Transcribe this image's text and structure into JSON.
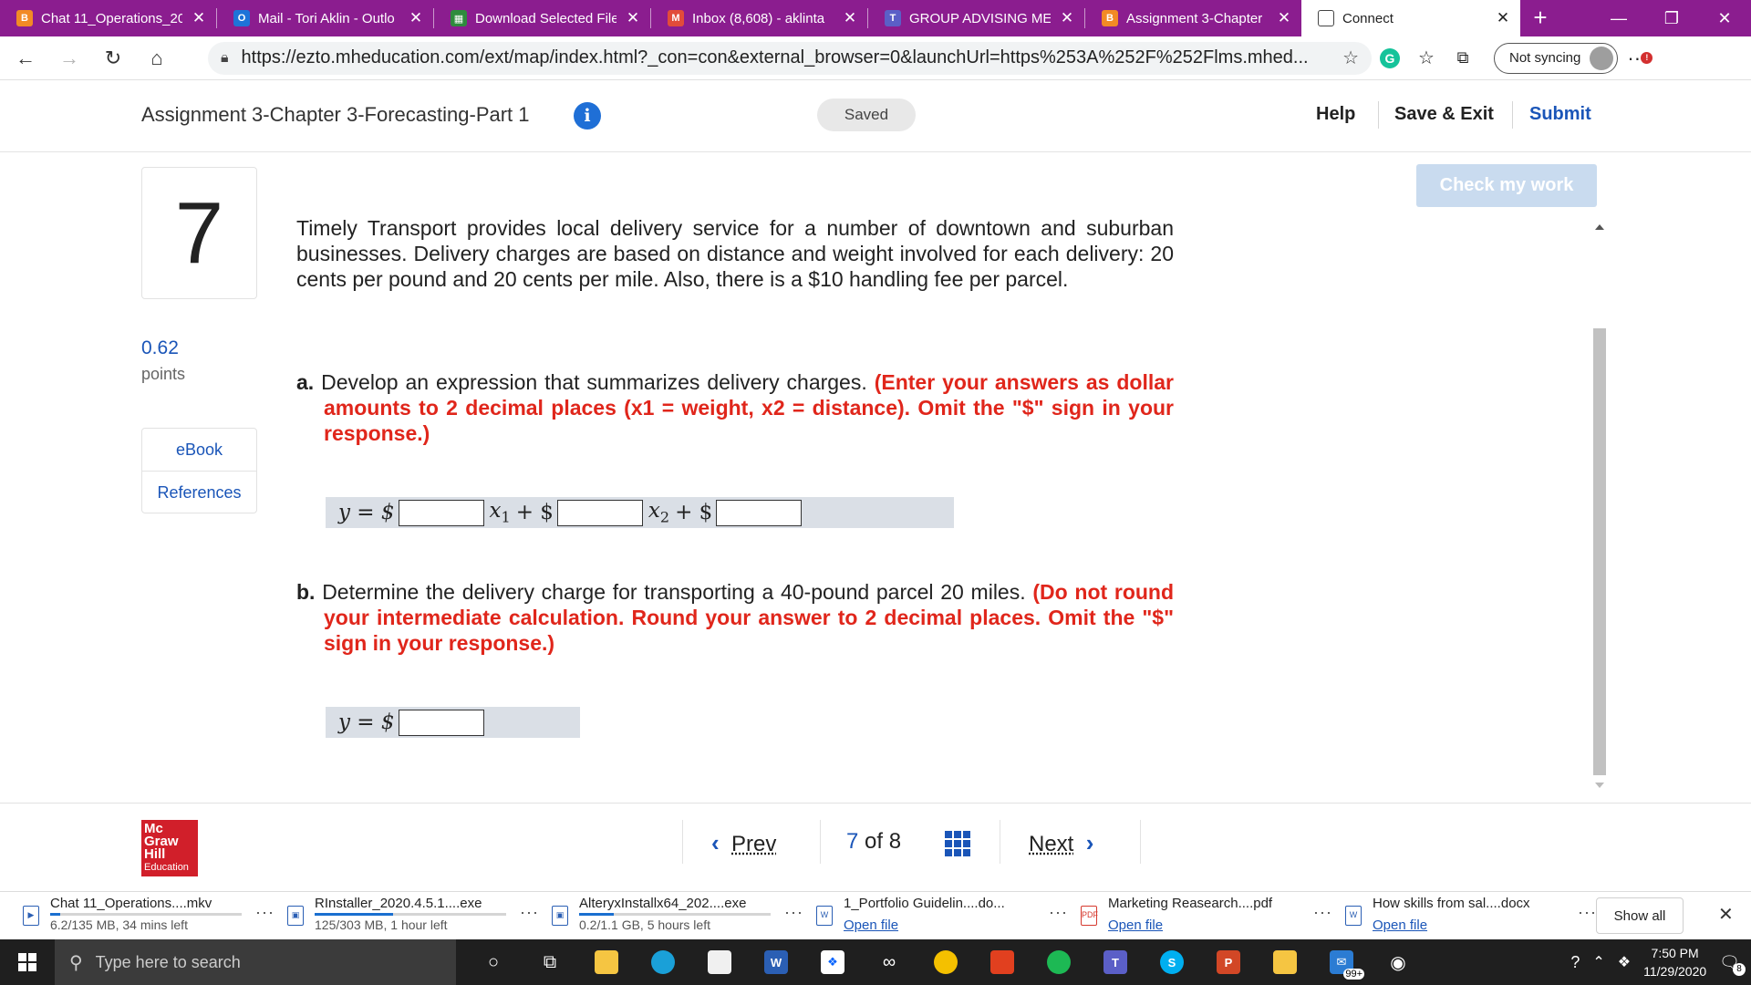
{
  "browser": {
    "tabs": [
      {
        "title": "Chat 11_Operations_20",
        "favicon": "B",
        "color": "#f28a25",
        "active": false
      },
      {
        "title": "Mail - Tori Aklin - Outlo",
        "favicon": "O",
        "color": "#1e73d8",
        "active": false
      },
      {
        "title": "Download Selected File",
        "favicon": "▦",
        "color": "#2e8b3d",
        "active": false
      },
      {
        "title": "Inbox (8,608) - aklinta",
        "favicon": "M",
        "color": "#e24c3a",
        "active": false
      },
      {
        "title": "GROUP ADVISING ME",
        "favicon": "T",
        "color": "#5b5fc7",
        "active": false
      },
      {
        "title": "Assignment 3-Chapter",
        "favicon": "B",
        "color": "#f28a25",
        "active": false
      },
      {
        "title": "Connect",
        "favicon": "▢",
        "color": "#ffffff",
        "active": true
      }
    ],
    "url": "https://ezto.mheducation.com/ext/map/index.html?_con=con&external_browser=0&launchUrl=https%253A%252F%252Flms.mhed...",
    "sync_label": "Not syncing",
    "menu_badge": "!"
  },
  "header": {
    "title": "Assignment 3-Chapter 3-Forecasting-Part 1",
    "info_glyph": "i",
    "saved": "Saved",
    "help": "Help",
    "save_exit": "Save & Exit",
    "submit": "Submit"
  },
  "question": {
    "number": "7",
    "points_value": "0.62",
    "points_label": "points",
    "ebook": "eBook",
    "references": "References",
    "check_button": "Check my work",
    "stem": "Timely Transport provides local delivery service for a number of downtown and suburban businesses. Delivery charges are based on distance and weight involved for each delivery: 20 cents per pound and 20 cents per mile. Also, there is a $10 handling fee per parcel.",
    "part_a": {
      "label": "a.",
      "text": "Develop an expression that summarizes delivery charges.",
      "instruction": "(Enter your answers as dollar amounts to 2 decimal places (x1 = weight, x2 = distance).  Omit the \"$\" sign in your response.)",
      "y_prefix": "y = $",
      "x1_label": "x",
      "x1_sub": "1",
      "plus1": "+ $",
      "x2_label": "x",
      "x2_sub": "2",
      "plus2": "+ $",
      "values": [
        "",
        "",
        ""
      ]
    },
    "part_b": {
      "label": "b.",
      "text": "Determine the delivery charge for transporting a 40-pound parcel 20 miles.",
      "instruction": "(Do not round your intermediate calculation. Round your answer to 2 decimal places. Omit the \"$\" sign in your response.)",
      "y_prefix": "y = $",
      "value": ""
    }
  },
  "footer": {
    "logo_lines": [
      "Mc",
      "Graw",
      "Hill"
    ],
    "logo_sub": "Education",
    "prev": "Prev",
    "page_current": "7",
    "page_of": "of",
    "page_total": "8",
    "next": "Next"
  },
  "downloads": {
    "items": [
      {
        "name": "Chat 11_Operations....mkv",
        "status": "6.2/135 MB, 34 mins left",
        "progress": 0.05,
        "kind": "video"
      },
      {
        "name": "RInstaller_2020.4.5.1....exe",
        "status": "125/303 MB, 1 hour left",
        "progress": 0.41,
        "kind": "exe"
      },
      {
        "name": "AlteryxInstallx64_202....exe",
        "status": "0.2/1.1 GB, 5 hours left",
        "progress": 0.18,
        "kind": "exe"
      },
      {
        "name": "1_Portfolio Guidelin....do...",
        "status": "Open file",
        "progress": null,
        "kind": "doc"
      },
      {
        "name": "Marketing Reasearch....pdf",
        "status": "Open file",
        "progress": null,
        "kind": "pdf"
      },
      {
        "name": "How skills from sal....docx",
        "status": "Open file",
        "progress": null,
        "kind": "doc"
      }
    ],
    "show_all": "Show all"
  },
  "taskbar": {
    "search_placeholder": "Type here to search",
    "time": "7:50 PM",
    "date": "11/29/2020",
    "notif_count": "8",
    "mail_badge": "99+"
  }
}
